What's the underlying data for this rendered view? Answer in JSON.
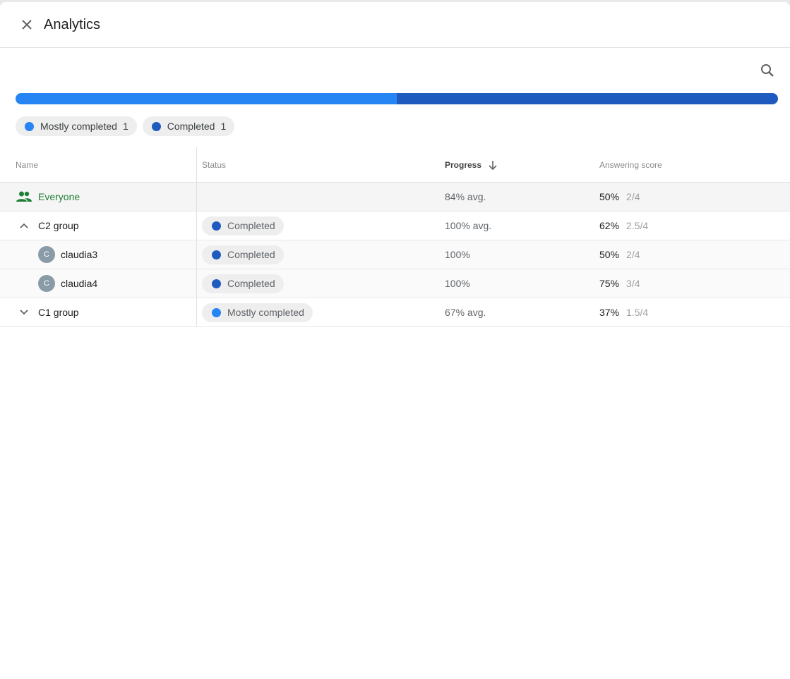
{
  "dialog": {
    "title": "Analytics"
  },
  "colors": {
    "mostly_completed": "#2684f3",
    "completed": "#1f5bbf",
    "everyone_green": "#1e7e34"
  },
  "progress_bar": {
    "mostly_completed_fraction": 0.5,
    "completed_fraction": 0.5
  },
  "legend": [
    {
      "label": "Mostly completed",
      "count": "1",
      "color": "#2684f3"
    },
    {
      "label": "Completed",
      "count": "1",
      "color": "#1f5bbf"
    }
  ],
  "table": {
    "headers": {
      "name": "Name",
      "status": "Status",
      "progress": "Progress",
      "score": "Answering score"
    },
    "rows": [
      {
        "name": "Everyone",
        "status": "",
        "progress": "84% avg.",
        "score_pct": "50%",
        "score_frac": "2/4"
      },
      {
        "name": "C2 group",
        "status": "Completed",
        "progress": "100% avg.",
        "score_pct": "62%",
        "score_frac": "2.5/4"
      },
      {
        "name": "claudia3",
        "avatar": "C",
        "status": "Completed",
        "progress": "100%",
        "score_pct": "50%",
        "score_frac": "2/4"
      },
      {
        "name": "claudia4",
        "avatar": "C",
        "status": "Completed",
        "progress": "100%",
        "score_pct": "75%",
        "score_frac": "3/4"
      },
      {
        "name": "C1 group",
        "status": "Mostly completed",
        "progress": "67% avg.",
        "score_pct": "37%",
        "score_frac": "1.5/4"
      }
    ]
  }
}
